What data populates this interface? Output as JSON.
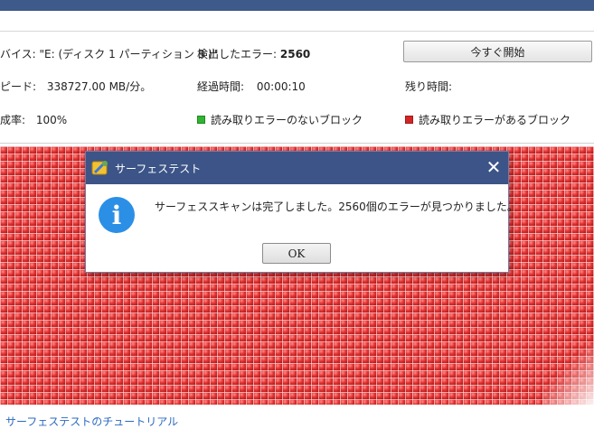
{
  "header": {
    "device_label": "バイス: \"E: (ディスク 1 パーティション 3 )\"",
    "errors_label": "検出したエラー:",
    "errors_value": "2560",
    "start_button": "今すぐ開始",
    "speed_label": "ピード:",
    "speed_value": "338727.00 MB/分。",
    "elapsed_label": "経過時間:",
    "elapsed_value": "00:00:10",
    "remaining_label": "残り時間:",
    "success_label": "成率:",
    "success_value": "100%",
    "legend_ok": "読み取りエラーのないブロック",
    "legend_err": "読み取りエラーがあるブロック"
  },
  "colors": {
    "accent": "#3c5487",
    "ok_block": "#2fb52f",
    "error_block": "#d42424",
    "info_icon": "#2b8fe6"
  },
  "dialog": {
    "title": "サーフェステスト",
    "message": "サーフェススキャンは完了しました。2560個のエラーが見つかりました。",
    "ok": "OK",
    "icon": "info-icon"
  },
  "footer": {
    "tutorial_link": "サーフェステストのチュートリアル"
  }
}
